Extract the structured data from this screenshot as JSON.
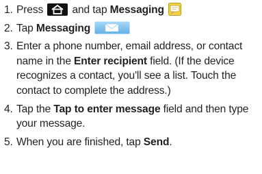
{
  "steps": [
    {
      "number": "1.",
      "p1": "Press",
      "p2": "and tap",
      "bold1": "Messaging",
      "home_icon": "home-key-icon",
      "messaging_icon": "messaging-app-icon"
    },
    {
      "number": "2.",
      "p1": "Tap",
      "bold1": "Messaging",
      "messaging_icon": "messaging-tab-icon"
    },
    {
      "number": "3.",
      "p1": "Enter a phone number, email address, or contact name in the",
      "bold1": "Enter recipient",
      "p2": "field. (If the device recognizes a contact, you'll see a list. Touch the contact to complete the address.)"
    },
    {
      "number": "4.",
      "p1": "Tap the",
      "bold1": "Tap to enter message",
      "p2": "field and then type your message."
    },
    {
      "number": "5.",
      "p1": "When you are finished, tap",
      "bold1": "Send",
      "p2": "."
    }
  ],
  "colors": {
    "text": "#231f20",
    "home_key_bg": "#111111",
    "messaging_icon_yellow": "#f2d24a",
    "messaging_tab_blue": "#7fc2f0"
  }
}
